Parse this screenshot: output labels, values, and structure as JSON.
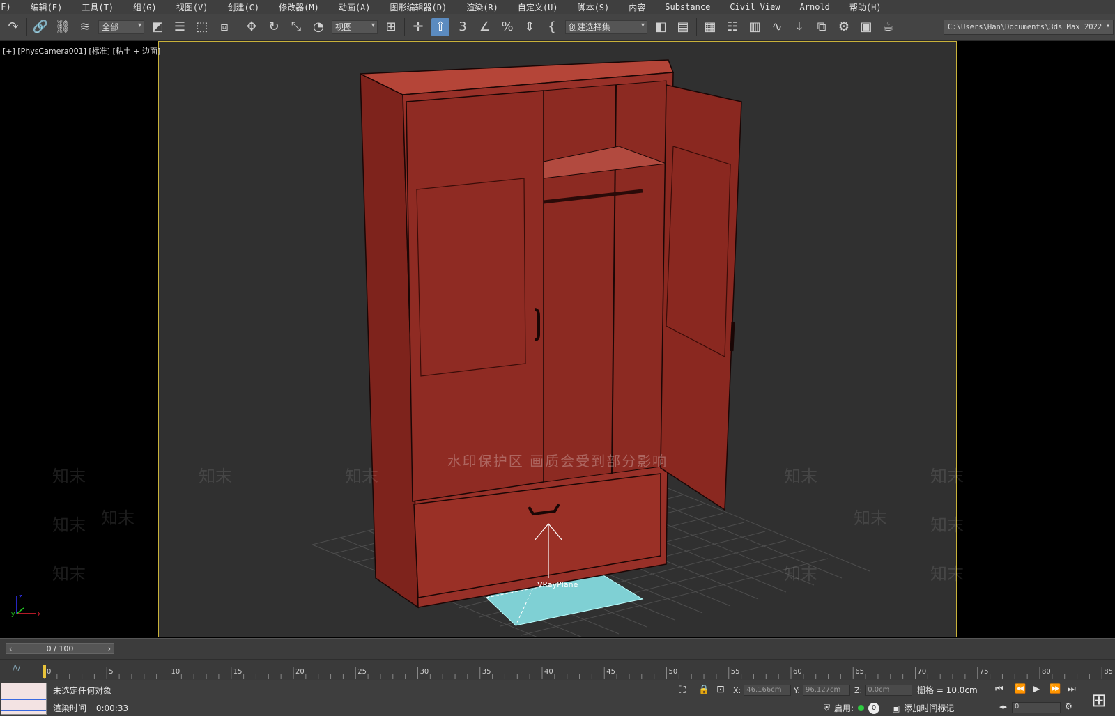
{
  "menu": [
    "(F)",
    "编辑(E)",
    "工具(T)",
    "组(G)",
    "视图(V)",
    "创建(C)",
    "修改器(M)",
    "动画(A)",
    "图形编辑器(D)",
    "渲染(R)",
    "自定义(U)",
    "脚本(S)",
    "内容",
    "Substance",
    "Civil View",
    "Arnold",
    "帮助(H)"
  ],
  "toolbar": {
    "selection_filter": "全部",
    "ref_coord": "视图",
    "named_selection": "创建选择集",
    "project_path": "C:\\Users\\Han\\Documents\\3ds Max 2022"
  },
  "viewport": {
    "label": "[+] [PhysCamera001] [标准] [粘土 + 边面]",
    "object_label": "VRayPlane",
    "watermark": "水印保护区  画质会受到部分影响",
    "watermark_logo": "知末",
    "colors": {
      "safe_frame": "#c9b23a",
      "wardrobe": "#9a3026",
      "plane": "#7fd0d4",
      "bg": "#303030"
    }
  },
  "timeline": {
    "frame_display": "0 / 100",
    "current_frame": 0,
    "total_frames": 100,
    "ruler_labels": [
      "0",
      "5",
      "10",
      "15",
      "20",
      "25",
      "30",
      "35",
      "40",
      "45",
      "50",
      "55",
      "60",
      "65",
      "70",
      "75",
      "80",
      "85"
    ]
  },
  "status": {
    "message": "未选定任何对象",
    "render_time_label": "渲染时间",
    "render_time": "0:00:33",
    "x_label": "X:",
    "x_value": "46.166cm",
    "y_label": "Y:",
    "y_value": "96.127cm",
    "z_label": "Z:",
    "z_value": "0.0cm",
    "grid": "栅格 = 10.0cm",
    "enable_label": "启用:",
    "add_time_tag": "添加时间标记",
    "zero_badge": "0",
    "frame_input": "0"
  },
  "icons": [
    "redo-icon",
    "link-icon",
    "unlink-icon",
    "bind-spacewarp-icon",
    "select-icon",
    "select-by-name-icon",
    "rect-select-icon",
    "window-crossing-icon",
    "move-icon",
    "rotate-icon",
    "scale-icon",
    "place-icon",
    "pivot-icon",
    "snap-3d-icon",
    "angle-snap-icon",
    "percent-snap-icon",
    "spinner-snap-icon",
    "named-sel-icon",
    "mirror-icon",
    "align-icon",
    "layers-icon",
    "ribbon-icon",
    "schematic-icon",
    "curve-editor-icon",
    "material-editor-icon",
    "render-setup-icon",
    "render-frame-icon",
    "render-icon",
    "teapot-icon"
  ]
}
